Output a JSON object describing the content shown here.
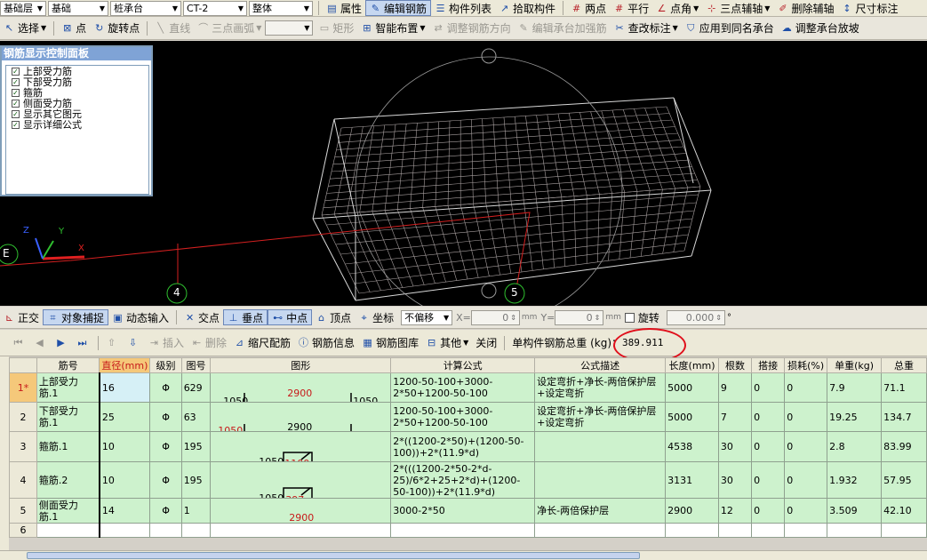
{
  "toolbar1": {
    "dd_floor": "基础层",
    "dd_cat": "基础",
    "dd_type": "桩承台",
    "dd_name": "CT-2",
    "dd_scope": "整体",
    "btn_props": "属性",
    "btn_edit_rebar": "编辑钢筋",
    "btn_list": "构件列表",
    "btn_pick": "拾取构件",
    "btn_two_pt": "两点",
    "btn_parallel": "平行",
    "btn_pt_angle": "点角",
    "btn_three_pt_axis": "三点辅轴",
    "btn_del_axis": "删除辅轴",
    "btn_dim": "尺寸标注"
  },
  "toolbar2": {
    "select": "选择",
    "point": "点",
    "rotate_pt": "旋转点",
    "line": "直线",
    "arc": "三点画弧",
    "dd_blank": "",
    "rect": "矩形",
    "smart_layout": "智能布置",
    "adjust_dir": "调整钢筋方向",
    "edit_reinforce": "编辑承台加强筋",
    "check_mark": "查改标注",
    "apply_same": "应用到同名承台",
    "adjust_slope": "调整承台放坡"
  },
  "viewport": {
    "panel_title": "钢筋显示控制面板",
    "panel_items": [
      "上部受力筋",
      "下部受力筋",
      "箍筋",
      "侧面受力筋",
      "显示其它图元",
      "显示详细公式"
    ],
    "axis_e": "E",
    "axis_4": "4",
    "axis_5": "5",
    "axis_x": "X",
    "axis_y": "Y",
    "axis_z": "Z"
  },
  "toolbar3": {
    "ortho": "正交",
    "snap": "对象捕捉",
    "dyn_input": "动态输入",
    "intersect": "交点",
    "perp": "垂点",
    "mid": "中点",
    "vertex": "顶点",
    "coord": "坐标",
    "offset_mode": "不偏移",
    "x_label": "X=",
    "x_val": "0",
    "y_label": "Y=",
    "y_val": "0",
    "unit": "mm",
    "rotate": "旋转",
    "rotate_val": "0.000",
    "deg": "°"
  },
  "toolbar4": {
    "insert": "插入",
    "delete": "删除",
    "scale_rebar": "缩尺配筋",
    "rebar_info": "钢筋信息",
    "rebar_lib": "钢筋图库",
    "other": "其他",
    "close": "关闭",
    "total_label": "单构件钢筋总重 (kg)：",
    "total_value": "389.911"
  },
  "table": {
    "headers": [
      "筋号",
      "直径(mm)",
      "级别",
      "图号",
      "图形",
      "计算公式",
      "公式描述",
      "长度(mm)",
      "根数",
      "搭接",
      "损耗(%)",
      "单重(kg)",
      "总重"
    ],
    "rows": [
      {
        "idx": "1*",
        "name": "上部受力筋.1",
        "dia": "16",
        "grade": "Φ",
        "fig": "629",
        "shape_l": "1050",
        "shape_m": "2900",
        "shape_r": "1050",
        "formula": "1200-50-100+3000-2*50+1200-50-100",
        "desc": "设定弯折+净长-两倍保护层+设定弯折",
        "len": "5000",
        "cnt": "9",
        "lap": "0",
        "loss": "0",
        "unit_w": "7.9",
        "total_w": "71.1"
      },
      {
        "idx": "2",
        "name": "下部受力筋.1",
        "dia": "25",
        "grade": "Φ",
        "fig": "63",
        "shape_l": "1050",
        "shape_m": "2900",
        "shape_r": "",
        "formula": "1200-50-100+3000-2*50+1200-50-100",
        "desc": "设定弯折+净长-两倍保护层+设定弯折",
        "len": "5000",
        "cnt": "7",
        "lap": "0",
        "loss": "0",
        "unit_w": "19.25",
        "total_w": "134.7"
      },
      {
        "idx": "3",
        "name": "箍筋.1",
        "dia": "10",
        "grade": "Φ",
        "fig": "195",
        "shape_l": "1050",
        "shape_m": "1100",
        "shape_r": "",
        "formula": "2*((1200-2*50)+(1200-50-100))+2*(11.9*d)",
        "desc": "",
        "len": "4538",
        "cnt": "30",
        "lap": "0",
        "loss": "0",
        "unit_w": "2.8",
        "total_w": "83.99"
      },
      {
        "idx": "4",
        "name": "箍筋.2",
        "dia": "10",
        "grade": "Φ",
        "fig": "195",
        "shape_l": "1050",
        "shape_m": "397",
        "shape_r": "",
        "formula": "2*(((1200-2*50-2*d-25)/6*2+25+2*d)+(1200-50-100))+2*(11.9*d)",
        "desc": "",
        "len": "3131",
        "cnt": "30",
        "lap": "0",
        "loss": "0",
        "unit_w": "1.932",
        "total_w": "57.95"
      },
      {
        "idx": "5",
        "name": "侧面受力筋.1",
        "dia": "14",
        "grade": "Φ",
        "fig": "1",
        "shape_l": "",
        "shape_m": "2900",
        "shape_r": "",
        "formula": "3000-2*50",
        "desc": "净长-两倍保护层",
        "len": "2900",
        "cnt": "12",
        "lap": "0",
        "loss": "0",
        "unit_w": "3.509",
        "total_w": "42.10"
      },
      {
        "idx": "6",
        "name": "",
        "dia": "",
        "grade": "",
        "fig": "",
        "shape_l": "",
        "shape_m": "",
        "shape_r": "",
        "formula": "",
        "desc": "",
        "len": "",
        "cnt": "",
        "lap": "",
        "loss": "",
        "unit_w": "",
        "total_w": ""
      }
    ]
  }
}
